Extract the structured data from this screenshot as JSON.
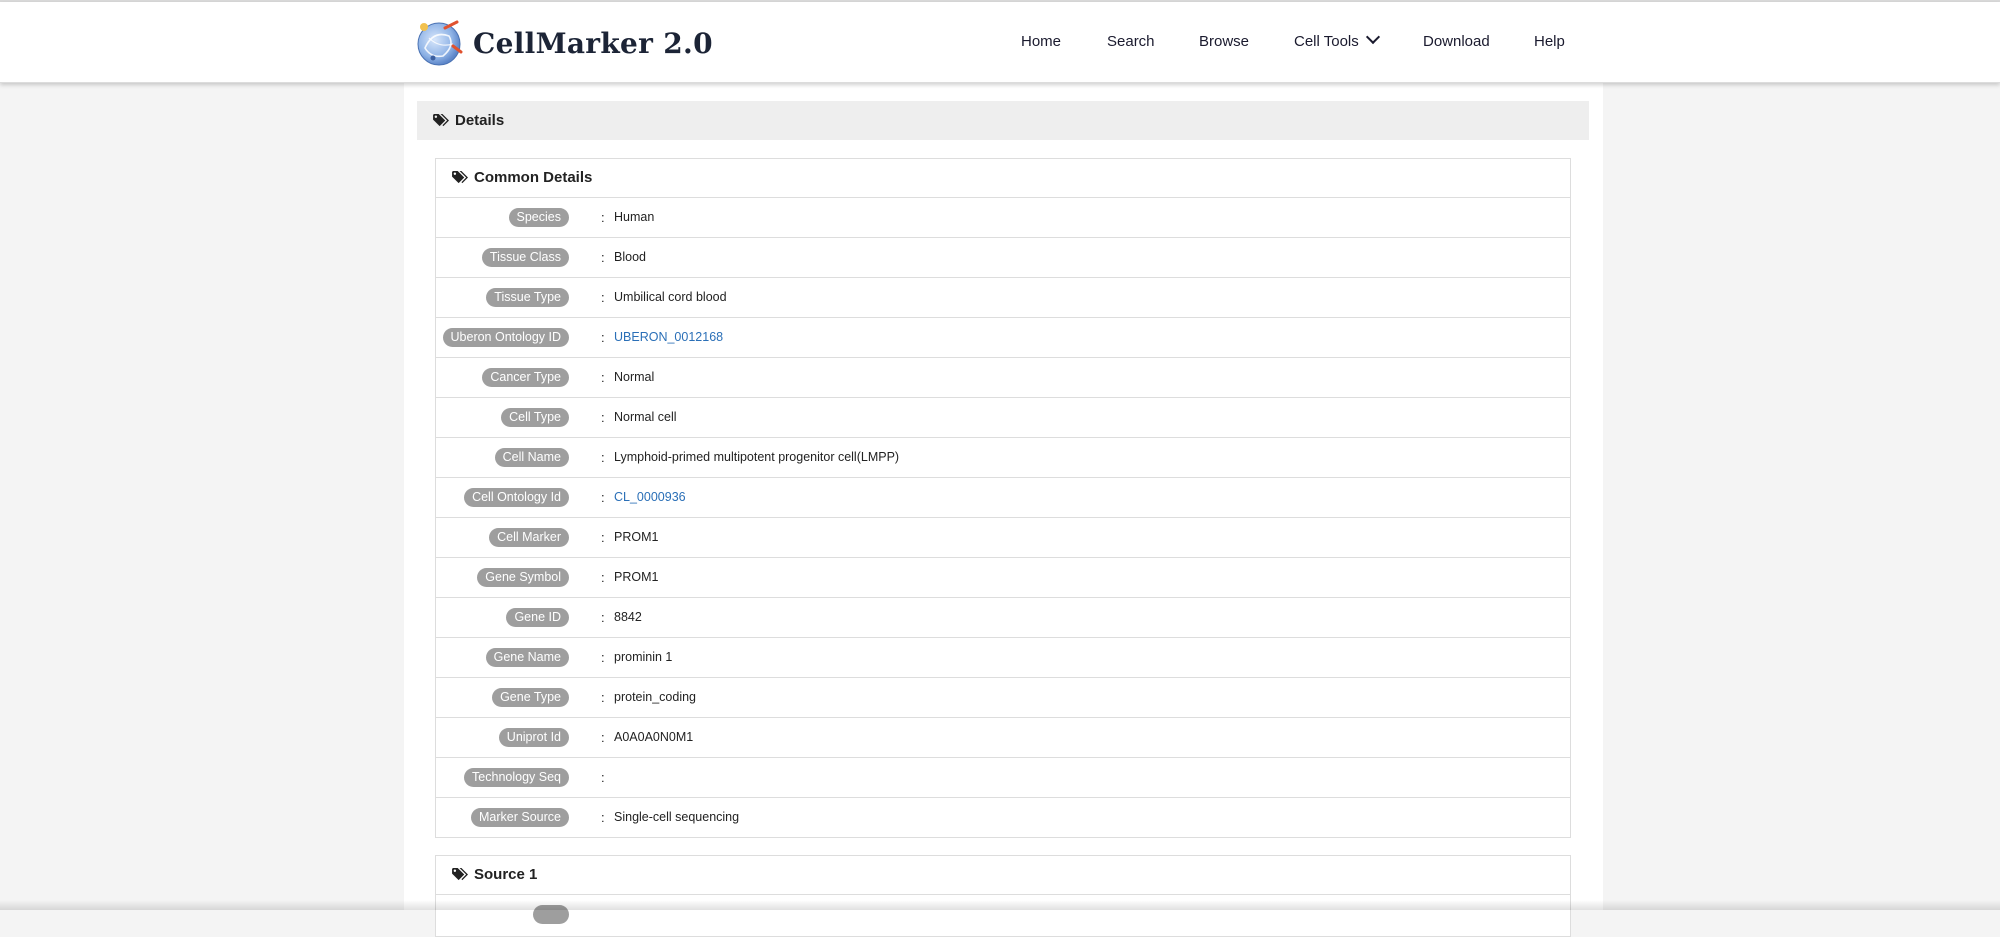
{
  "app": {
    "logo_text": "CellMarker 2.0"
  },
  "nav": {
    "home": "Home",
    "search": "Search",
    "browse": "Browse",
    "cell_tools": "Cell Tools",
    "download": "Download",
    "help": "Help"
  },
  "details": {
    "title": "Details"
  },
  "common_details": {
    "title": "Common Details",
    "rows": [
      {
        "label": "Species",
        "value": "Human"
      },
      {
        "label": "Tissue Class",
        "value": "Blood"
      },
      {
        "label": "Tissue Type",
        "value": "Umbilical cord blood"
      },
      {
        "label": "Uberon Ontology ID",
        "value": "UBERON_0012168"
      },
      {
        "label": "Cancer Type",
        "value": "Normal"
      },
      {
        "label": "Cell Type",
        "value": "Normal cell"
      },
      {
        "label": "Cell Name",
        "value": "Lymphoid-primed multipotent progenitor cell(LMPP)"
      },
      {
        "label": "Cell Ontology Id",
        "value": "CL_0000936"
      },
      {
        "label": "Cell Marker",
        "value": "PROM1"
      },
      {
        "label": "Gene Symbol",
        "value": "PROM1"
      },
      {
        "label": "Gene ID",
        "value": "8842"
      },
      {
        "label": "Gene Name",
        "value": "prominin 1"
      },
      {
        "label": "Gene Type",
        "value": "protein_coding"
      },
      {
        "label": "Uniprot Id",
        "value": "A0A0A0N0M1"
      },
      {
        "label": "Technology Seq",
        "value": ""
      },
      {
        "label": "Marker Source",
        "value": "Single-cell sequencing"
      }
    ],
    "colon": ":"
  },
  "source1": {
    "title": "Source 1"
  },
  "colors": {
    "link": "#2a6fb7",
    "pill": "#9e9e9e",
    "details_bar": "#eeeeee"
  },
  "icons": {
    "logo": "cellmarker-logo-icon",
    "section": "tags-icon",
    "dropdown": "chevron-down-icon"
  }
}
